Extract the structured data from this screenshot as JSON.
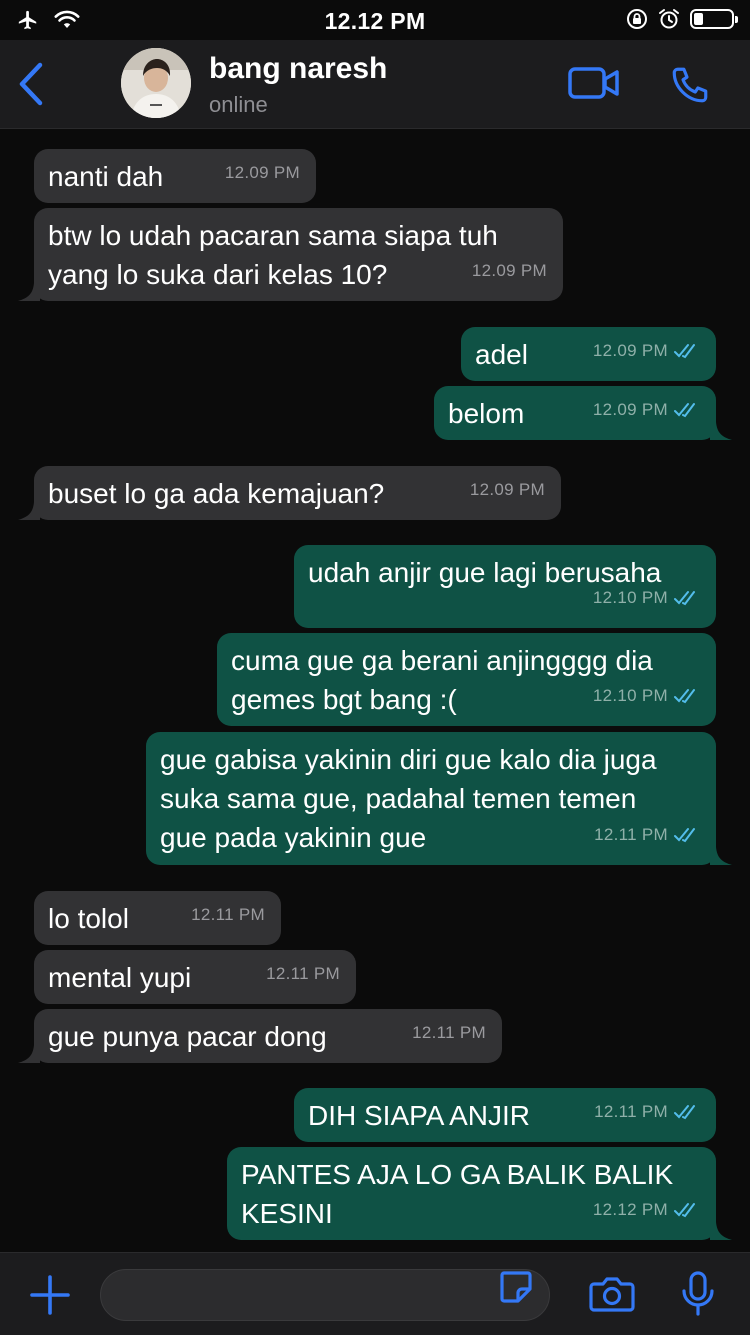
{
  "status_bar": {
    "time": "12.12 PM",
    "battery_level": 0.25
  },
  "header": {
    "back_icon": "chevron-left-icon",
    "contact_name": "bang naresh",
    "contact_status": "online",
    "video_icon": "video-camera-icon",
    "call_icon": "phone-icon",
    "accent_color": "#3478f6"
  },
  "messages": [
    {
      "dir": "in",
      "text": "nanti dah",
      "time": "12.09 PM"
    },
    {
      "dir": "in",
      "text": "btw lo udah pacaran sama siapa tuh\nyang lo suka dari kelas 10?",
      "time": "12.09 PM"
    },
    {
      "dir": "out",
      "text": "adel",
      "time": "12.09 PM"
    },
    {
      "dir": "out",
      "text": "belom",
      "time": "12.09 PM"
    },
    {
      "dir": "in",
      "text": "buset lo ga ada kemajuan?",
      "time": "12.09 PM"
    },
    {
      "dir": "out",
      "text": "udah anjir gue lagi berusaha",
      "time": "12.10 PM"
    },
    {
      "dir": "out",
      "text": "cuma gue ga berani anjingggg dia\ngemes bgt bang :(",
      "time": "12.10 PM"
    },
    {
      "dir": "out",
      "text": "gue gabisa yakinin diri gue kalo dia juga\nsuka sama gue, padahal temen temen\ngue pada yakinin gue",
      "time": "12.11 PM"
    },
    {
      "dir": "in",
      "text": "lo tolol",
      "time": "12.11 PM"
    },
    {
      "dir": "in",
      "text": "mental yupi",
      "time": "12.11 PM"
    },
    {
      "dir": "in",
      "text": "gue punya pacar dong",
      "time": "12.11 PM"
    },
    {
      "dir": "out",
      "text": "DIH SIAPA ANJIR",
      "time": "12.11 PM"
    },
    {
      "dir": "out",
      "text": "PANTES AJA LO GA BALIK BALIK\nKESINI",
      "time": "12.12 PM"
    }
  ],
  "colors": {
    "incoming_bubble": "#323234",
    "outgoing_bubble": "#0f5245",
    "read_ticks": "#53bdeb"
  },
  "input_bar": {
    "plus_icon": "plus-icon",
    "message_placeholder": "",
    "sticker_icon": "sticker-icon",
    "camera_icon": "camera-icon",
    "mic_icon": "microphone-icon"
  }
}
